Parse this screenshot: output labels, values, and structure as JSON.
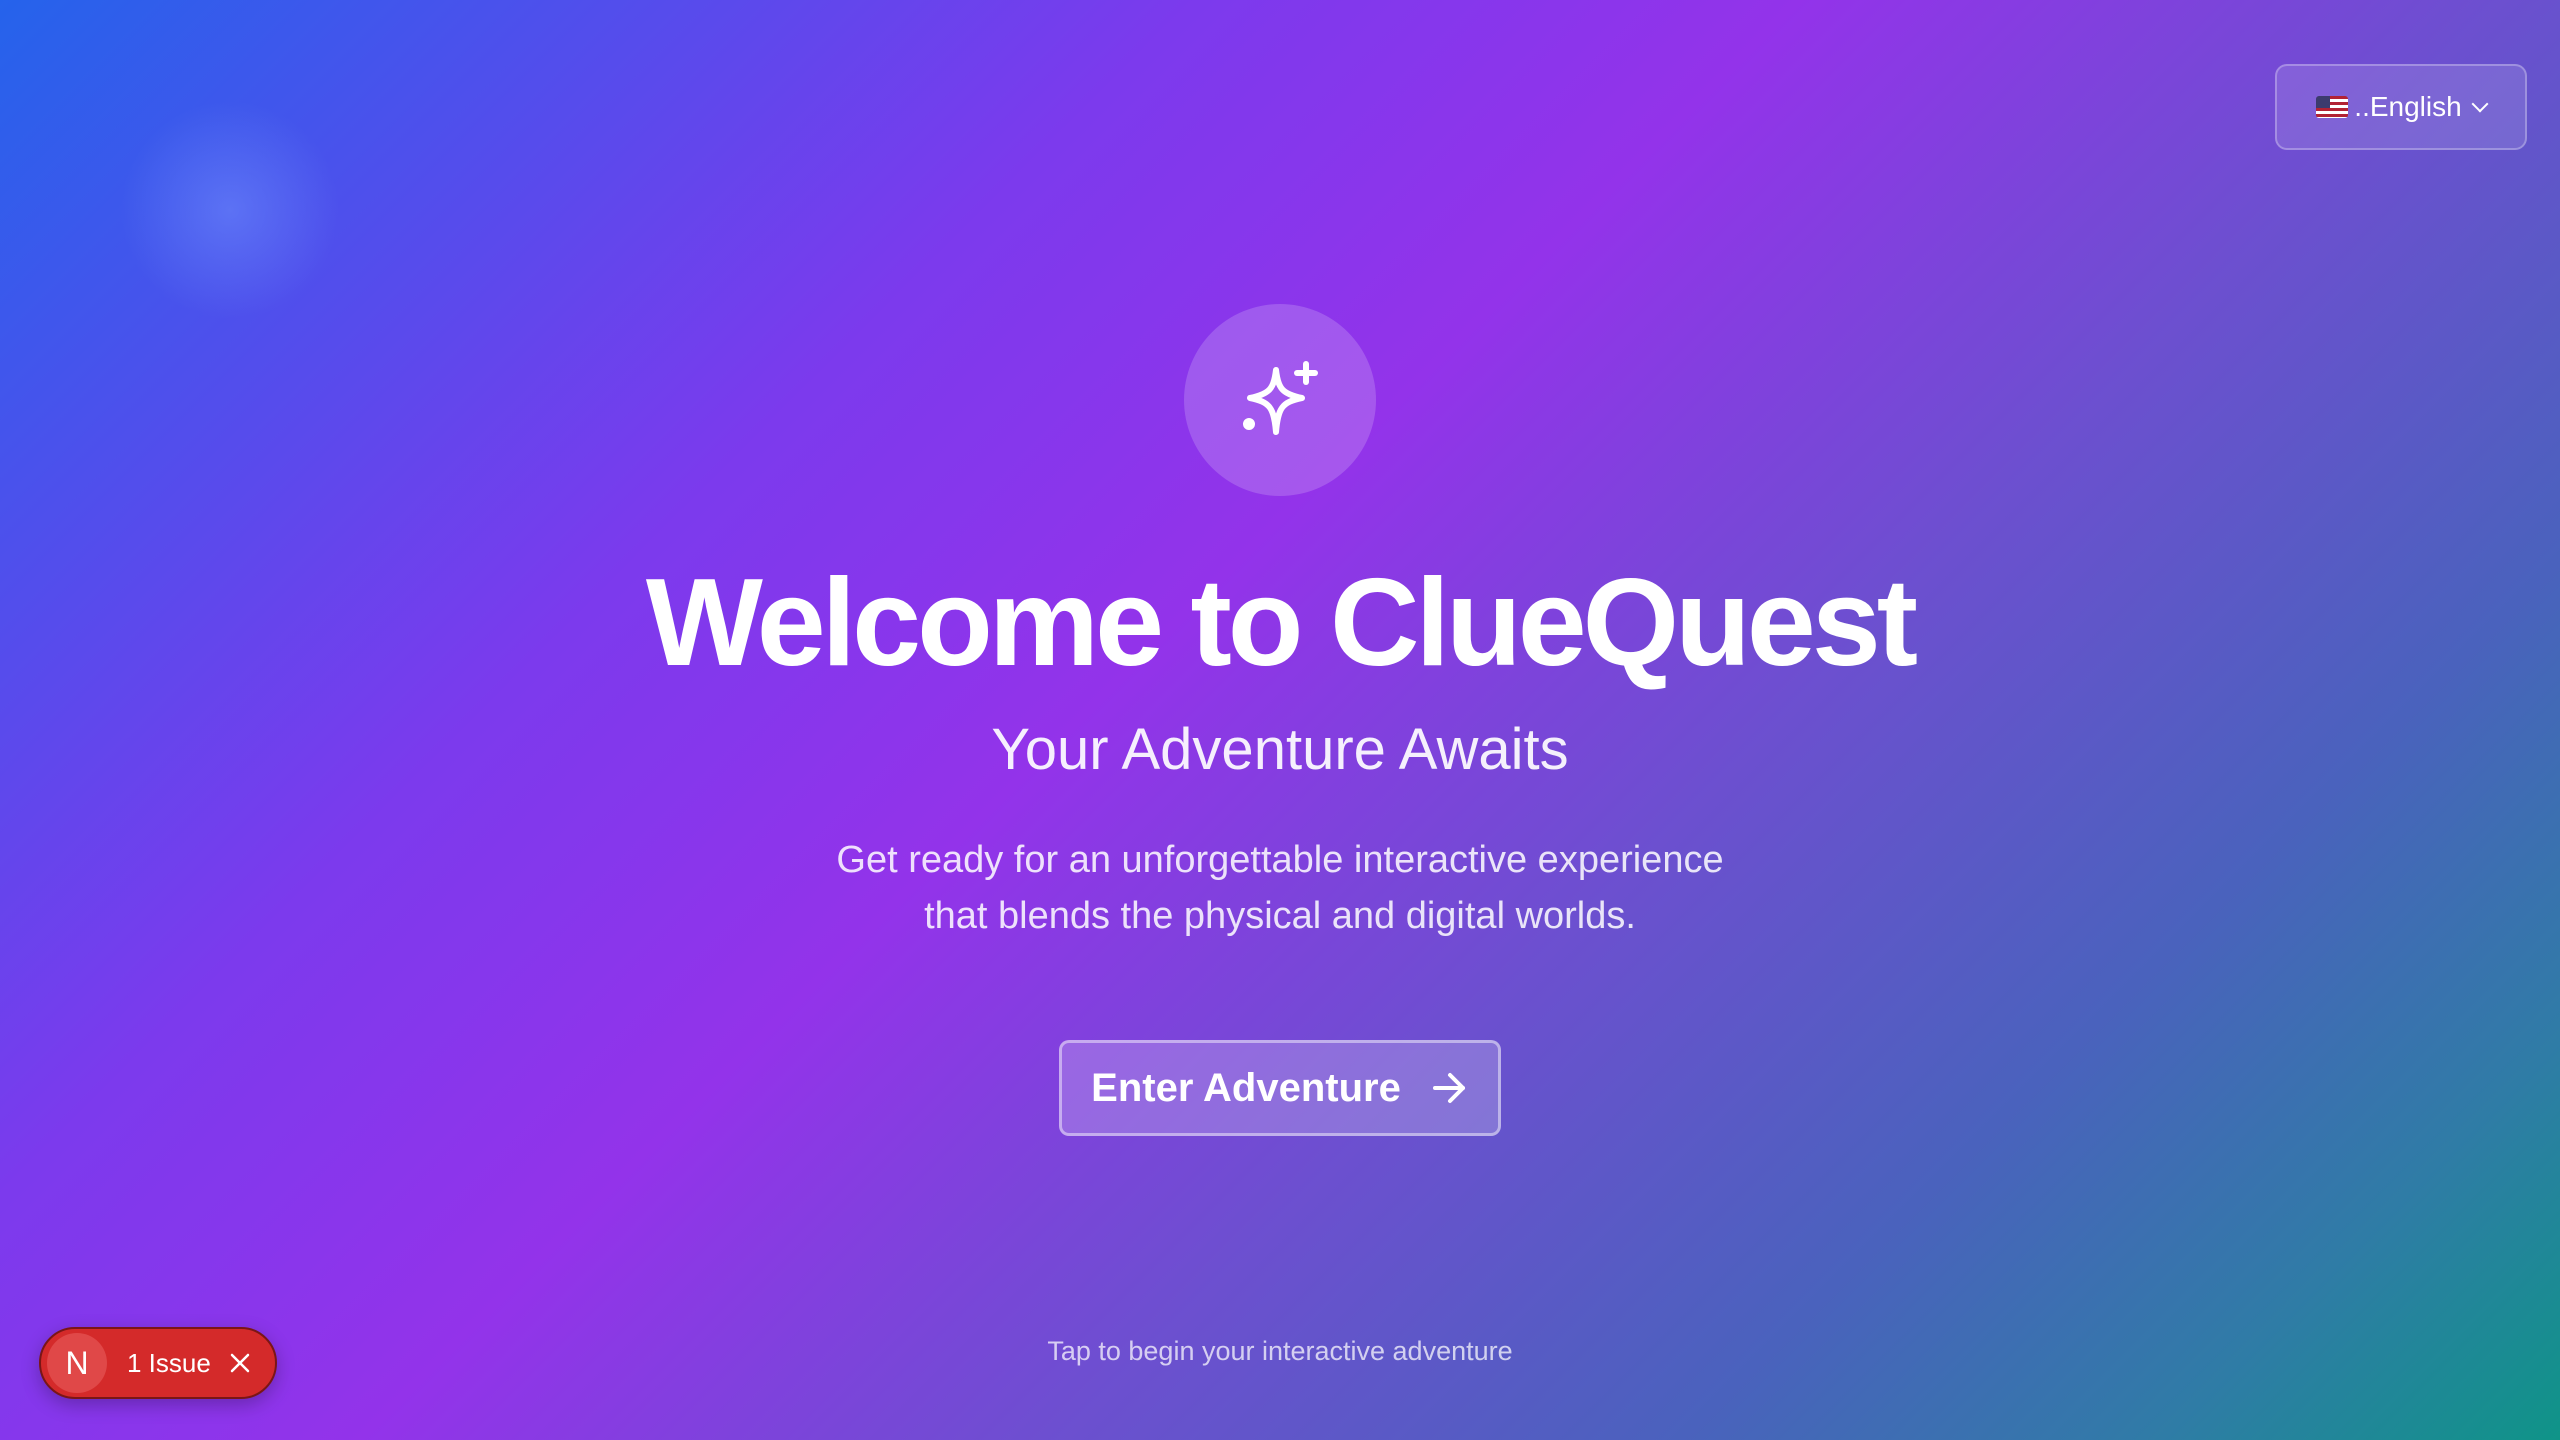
{
  "language_selector": {
    "flag_icon": "us-flag-icon",
    "label": "..English",
    "chevron_icon": "chevron-down-icon"
  },
  "hero": {
    "icon": "sparkles-icon",
    "title": "Welcome to ClueQuest",
    "subtitle": "Your Adventure Awaits",
    "description_line1": "Get ready for an unforgettable interactive experience",
    "description_line2": "that blends the physical and digital worlds."
  },
  "cta": {
    "label": "Enter Adventure",
    "icon": "arrow-right-icon"
  },
  "footer_hint": "Tap to begin your interactive adventure",
  "dev_overlay": {
    "logo_letter": "N",
    "issue_label": "1 Issue",
    "close_icon": "close-icon",
    "color": "#d42a2a"
  },
  "colors": {
    "gradient_start": "#2563eb",
    "gradient_mid": "#9333ea",
    "gradient_end": "#0f9488"
  }
}
